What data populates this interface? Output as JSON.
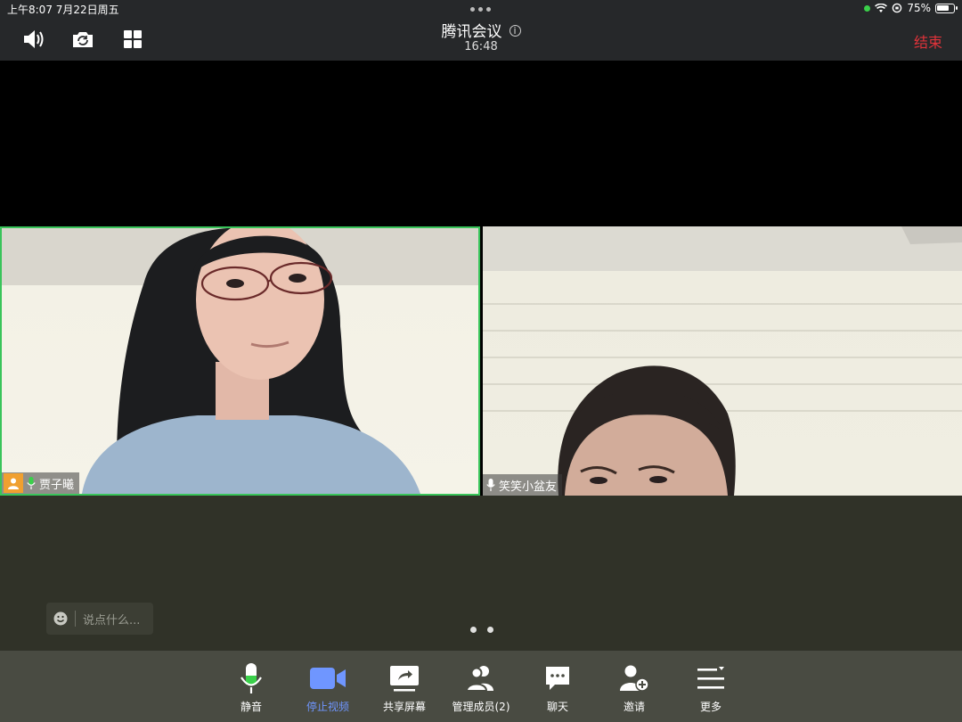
{
  "status_bar": {
    "time_date": "上午8:07   7月22日周五",
    "battery": "75%",
    "battery_level": 0.75
  },
  "header": {
    "title": "腾讯会议",
    "timer": "16:48",
    "end_label": "结束",
    "info_glyph": "i"
  },
  "participants": [
    {
      "name": "贾子曦",
      "host": true,
      "active_speaker": true
    },
    {
      "name": "笑笑小盆友",
      "host": false,
      "active_speaker": false
    }
  ],
  "chat": {
    "placeholder": "说点什么..."
  },
  "toolbar": {
    "mute": "静音",
    "stop_video": "停止视频",
    "share_screen": "共享屏幕",
    "manage_members": "管理成员(2)",
    "chat": "聊天",
    "invite": "邀请",
    "more": "更多"
  },
  "colors": {
    "accent": "#6f96ff",
    "end": "#e0333a",
    "speaker_border": "#39c45a",
    "mic_green": "#3ad04a"
  },
  "icons": [
    "speaker-icon",
    "camera-switch-icon",
    "grid-icon",
    "info-icon",
    "mic-icon",
    "video-camera-icon",
    "share-screen-icon",
    "members-icon",
    "chat-bubble-icon",
    "add-user-icon",
    "more-menu-icon",
    "emoji-icon",
    "host-avatar-icon"
  ],
  "pagination": {
    "pages": 2
  }
}
